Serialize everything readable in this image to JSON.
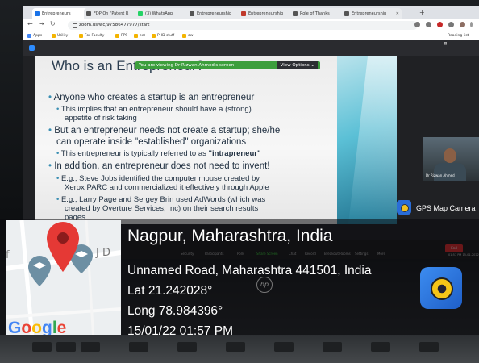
{
  "browser": {
    "tabs": [
      {
        "label": "Entrepreneurs"
      },
      {
        "label": "FDP On \"Patent R"
      },
      {
        "label": "(3) WhatsApp"
      },
      {
        "label": "Entrepreneurship"
      },
      {
        "label": "Entrepreneurship"
      },
      {
        "label": "Role of Thanks"
      },
      {
        "label": "Entrepreneurship"
      }
    ],
    "url": "zoom.us/wc/97586477977/start",
    "bookmarks": [
      {
        "label": "Apps"
      },
      {
        "label": "Utility"
      },
      {
        "label": "For Faculty"
      },
      {
        "label": "PPS"
      },
      {
        "label": "ect"
      },
      {
        "label": "PHD stuff"
      },
      {
        "label": "ow"
      }
    ],
    "reading_list": "Reading list"
  },
  "zoom": {
    "banner": "You are viewing Dr Rizwan Ahmed's screen",
    "view_options": "View Options",
    "participant_name": "Dr Rizwan Ahmed",
    "controls": [
      "Security",
      "Participants",
      "Polls",
      "Share Screen",
      "Chat",
      "Record",
      "Breakout Rooms",
      "Settings",
      "More"
    ],
    "end_label": "End",
    "time": "01:57 PM",
    "date": "15-01-2022"
  },
  "slide": {
    "title": "Who is an Entrepreneur?",
    "bullets": [
      {
        "level": 1,
        "text": "Anyone who creates a startup is an entrepreneur"
      },
      {
        "level": 2,
        "text": "This implies that an entrepreneur should have a (strong)"
      },
      {
        "level": 2,
        "text": "appetite of risk taking",
        "cont": true
      },
      {
        "level": 1,
        "text": "But an entrepreneur needs not create a startup; she/he"
      },
      {
        "level": 1,
        "text": "can operate inside \"established\" organizations",
        "cont": true
      },
      {
        "level": 2,
        "text": "This entrepreneur is typically referred to as ",
        "bold": "\"intrapreneur\""
      },
      {
        "level": 1,
        "text": "In addition, an entrepreneur does not need to invent!"
      },
      {
        "level": 2,
        "text": "E.g., Steve Jobs identified the computer mouse created by"
      },
      {
        "level": 2,
        "text": "Xerox PARC and commercialized it effectively through Apple",
        "cont": true
      },
      {
        "level": 2,
        "text": "E.g., Larry Page and Sergey Brin used AdWords (which was"
      },
      {
        "level": 2,
        "text": "created by Overture Services, Inc) on their search results",
        "cont": true
      },
      {
        "level": 2,
        "text": "pages",
        "cont": true
      }
    ]
  },
  "gps": {
    "app_name": "GPS Map Camera",
    "city": "Nagpur, Maharashtra, India",
    "address": "Unnamed Road, Maharashtra 441501, India",
    "lat": "Lat 21.242028°",
    "long": "Long 78.984396°",
    "datetime": "15/01/22 01:57 PM",
    "map_brand": "Google",
    "map_label": "J D"
  },
  "colors": {
    "pin": "#e53935",
    "slide_text": "#1f2f40",
    "bullet": "#3b8fb3",
    "zoom_banner": "#3c9e3c"
  }
}
